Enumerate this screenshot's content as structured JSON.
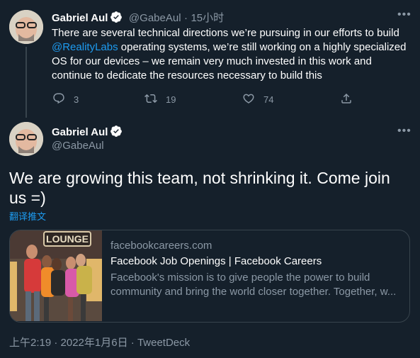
{
  "reply_tweet": {
    "author_name": "Gabriel Aul",
    "handle": "@GabeAul",
    "separator": "·",
    "time_ago": "15小时",
    "text_before_mention": "There are several technical directions we’re pursuing in our efforts to build",
    "mention": "@RealityLabs",
    "text_after_mention": " operating systems, we’re still working on a highly specialized OS for our devices – we remain very much invested in this work and continue to dedicate the resources necessary to build this",
    "reply_count": "3",
    "retweet_count": "19",
    "like_count": "74"
  },
  "main_tweet": {
    "author_name": "Gabriel Aul",
    "handle": "@GabeAul",
    "text": "We are growing this team, not shrinking it. Come join us =)",
    "translate_label": "翻译推文",
    "card": {
      "image_sign": "LOUNGE",
      "domain": "facebookcareers.com",
      "title": "Facebook Job Openings | Facebook Careers",
      "description": "Facebook's mission is to give people the power to build community and bring the world closer together. Together, w..."
    },
    "timestamp": "上午2:19 · 2022年1月6日",
    "meta_separator": " · ",
    "source": "TweetDeck"
  },
  "colors": {
    "background": "#15202b",
    "accent": "#1d9bf0",
    "muted": "#8b98a5",
    "border": "#38444d"
  },
  "icons": [
    "reply-icon",
    "retweet-icon",
    "like-icon",
    "share-icon",
    "verified-badge-icon",
    "more-icon"
  ]
}
